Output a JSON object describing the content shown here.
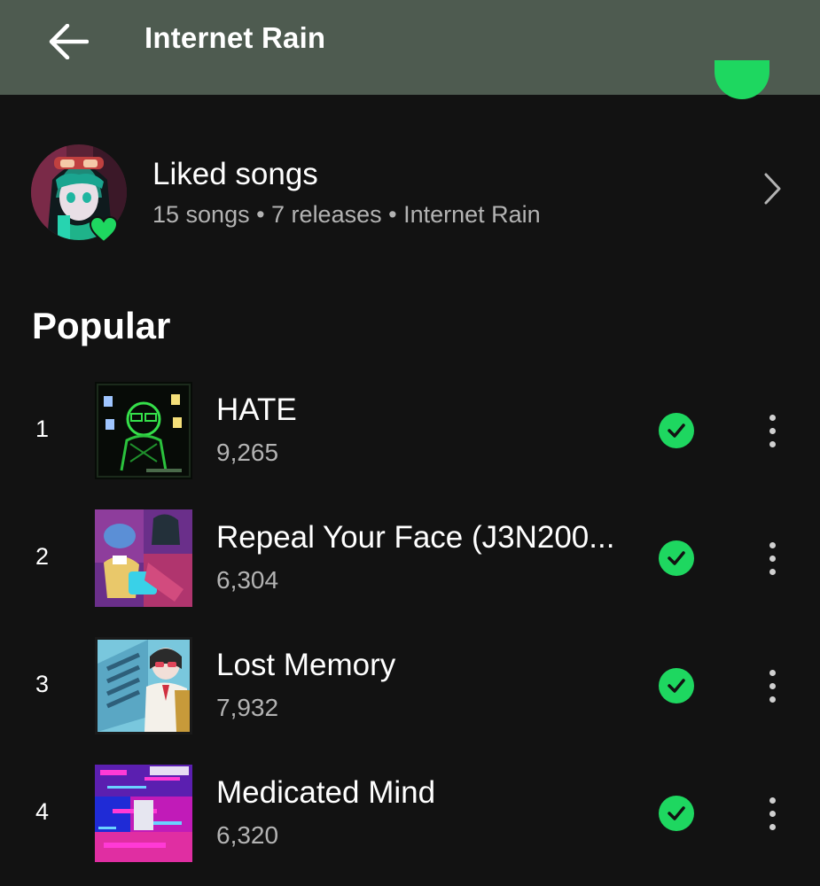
{
  "header": {
    "title": "Internet Rain",
    "back_icon": "arrow-left-icon"
  },
  "liked": {
    "title": "Liked songs",
    "subtitle": "15 songs • 7 releases • Internet Rain",
    "badge_icon": "heart-icon",
    "chevron_icon": "chevron-right-icon"
  },
  "popular": {
    "title": "Popular",
    "tracks": [
      {
        "rank": "1",
        "title": "HATE",
        "plays": "9,265",
        "downloaded": true
      },
      {
        "rank": "2",
        "title": "Repeal Your Face (J3N200...",
        "plays": "6,304",
        "downloaded": true
      },
      {
        "rank": "3",
        "title": "Lost Memory",
        "plays": "7,932",
        "downloaded": true
      },
      {
        "rank": "4",
        "title": "Medicated Mind",
        "plays": "6,320",
        "downloaded": true
      }
    ]
  },
  "colors": {
    "accent": "#1ed760",
    "background": "#121212",
    "header_bg": "#4e5b50",
    "secondary_text": "#b3b3b3"
  }
}
